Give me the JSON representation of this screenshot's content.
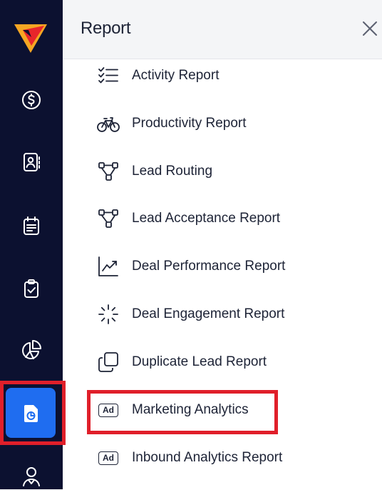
{
  "panel": {
    "title": "Report",
    "close_label": "×"
  },
  "sidebar": {
    "items": [
      {
        "name": "deals",
        "icon": "dollar-circle-icon"
      },
      {
        "name": "contacts",
        "icon": "contact-card-icon"
      },
      {
        "name": "calendar",
        "icon": "calendar-icon"
      },
      {
        "name": "tasks",
        "icon": "clipboard-check-icon"
      },
      {
        "name": "analytics",
        "icon": "pie-chart-icon"
      },
      {
        "name": "reports",
        "icon": "report-document-icon",
        "active": true
      },
      {
        "name": "users",
        "icon": "user-profile-icon"
      }
    ]
  },
  "menu": {
    "items": [
      {
        "label": "Activity Report",
        "icon": "checklist-icon"
      },
      {
        "label": "Productivity Report",
        "icon": "bicycle-icon"
      },
      {
        "label": "Lead Routing",
        "icon": "routing-nodes-icon"
      },
      {
        "label": "Lead Acceptance Report",
        "icon": "routing-nodes-icon"
      },
      {
        "label": "Deal Performance Report",
        "icon": "trend-chart-icon"
      },
      {
        "label": "Deal Engagement Report",
        "icon": "loader-icon"
      },
      {
        "label": "Duplicate Lead Report",
        "icon": "duplicate-icon"
      },
      {
        "label": "Marketing Analytics",
        "icon": "ad-badge-icon",
        "highlighted": true
      },
      {
        "label": "Inbound Analytics Report",
        "icon": "ad-badge-icon"
      }
    ],
    "ad_badge_text": "Ad"
  },
  "colors": {
    "sidebar_bg": "#0c1130",
    "active_bg": "#1f6df0",
    "highlight": "#e01f2a",
    "logo_orange": "#f5a623",
    "logo_red": "#e8262b"
  }
}
